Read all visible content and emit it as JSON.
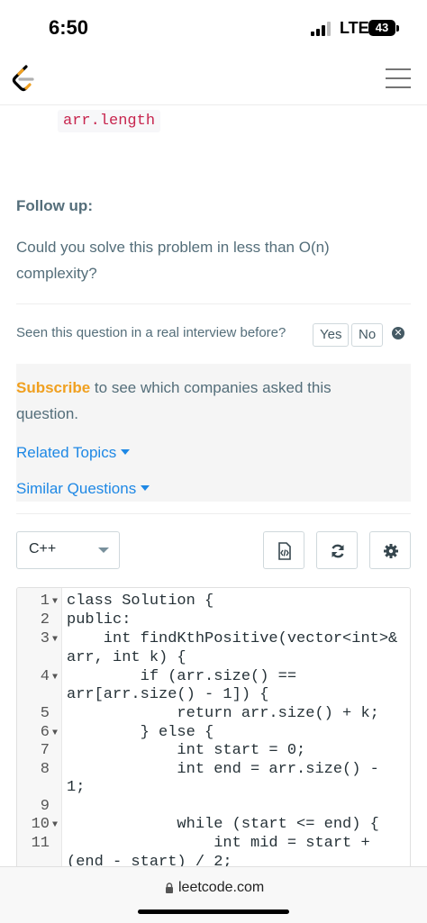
{
  "status_bar": {
    "time": "6:50",
    "network": "LTE",
    "battery": "43"
  },
  "header": {
    "logo_icon": "leetcode-logo",
    "menu_icon": "hamburger-icon"
  },
  "content": {
    "code_chip": "arr.length",
    "followup_heading": "Follow up:",
    "followup_text": "Could you solve this problem in less than O(n) complexity?",
    "seen_question": "Seen this question in a real interview before?",
    "yes_label": "Yes",
    "no_label": "No",
    "subscribe_link": "Subscribe",
    "subscribe_rest": " to see which companies asked this question.",
    "related_topics": "Related Topics",
    "similar_questions": "Similar Questions"
  },
  "editor": {
    "language": "C++",
    "line_numbers": [
      "1",
      "2",
      "3",
      "4",
      "5",
      "6",
      "7",
      "8",
      "9",
      "10",
      "11"
    ],
    "lines": [
      "class Solution {",
      "public:",
      "    int findKthPositive(vector<int>&",
      "arr, int k) {",
      "        if (arr.size() ==",
      "arr[arr.size() - 1]) {",
      "            return arr.size() + k;",
      "        } else {",
      "            int start = 0;",
      "            int end = arr.size() -",
      "1;",
      "",
      "            while (start <= end) {",
      "                int mid = start +",
      "(end - start) / 2;"
    ]
  },
  "browser": {
    "url": "leetcode.com"
  },
  "colors": {
    "accent_orange": "#f0a020",
    "link_blue": "#1e88e5",
    "keyword_blue": "#0033b3"
  }
}
